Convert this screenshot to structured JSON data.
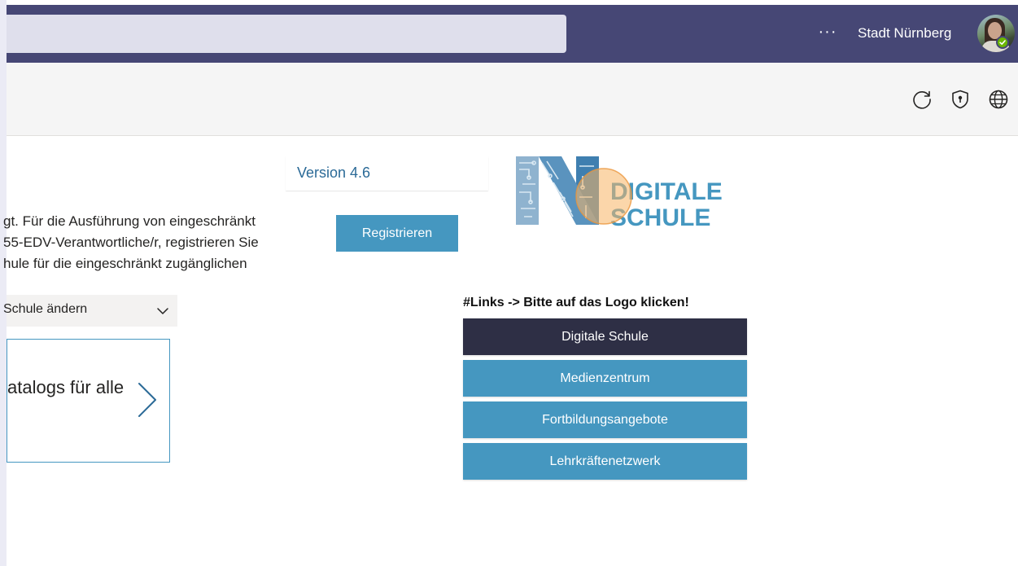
{
  "titlebar": {
    "more_label": "···",
    "org_name": "Stadt Nürnberg",
    "avatar_status": "available"
  },
  "appbar": {
    "icons": [
      "refresh-icon",
      "shield-lock-icon",
      "globe-icon"
    ]
  },
  "content": {
    "version": "Version 4.6",
    "intro_lines": [
      "gt. Für die Ausführung von eingeschränkt",
      "55-EDV-Verantwortliche/r, registrieren Sie",
      "hule für die eingeschränkt zugänglichen"
    ],
    "register_label": "Registrieren",
    "logo_text": [
      "DIGITALE",
      "SCHULE"
    ],
    "select_label": "Schule ändern",
    "catalog_text": "atalogs für alle",
    "links_heading": "#Links -> Bitte auf das Logo klicken!",
    "links": [
      {
        "label": "Digitale Schule"
      },
      {
        "label": "Medienzentrum"
      },
      {
        "label": "Fortbildungsangebote"
      },
      {
        "label": "Lehrkräftenetzwerk"
      }
    ]
  },
  "colors": {
    "teams_purple": "#464775",
    "accent_blue": "#4597c0",
    "dark_link": "#2e2f45",
    "version_text": "#2b6a97"
  }
}
